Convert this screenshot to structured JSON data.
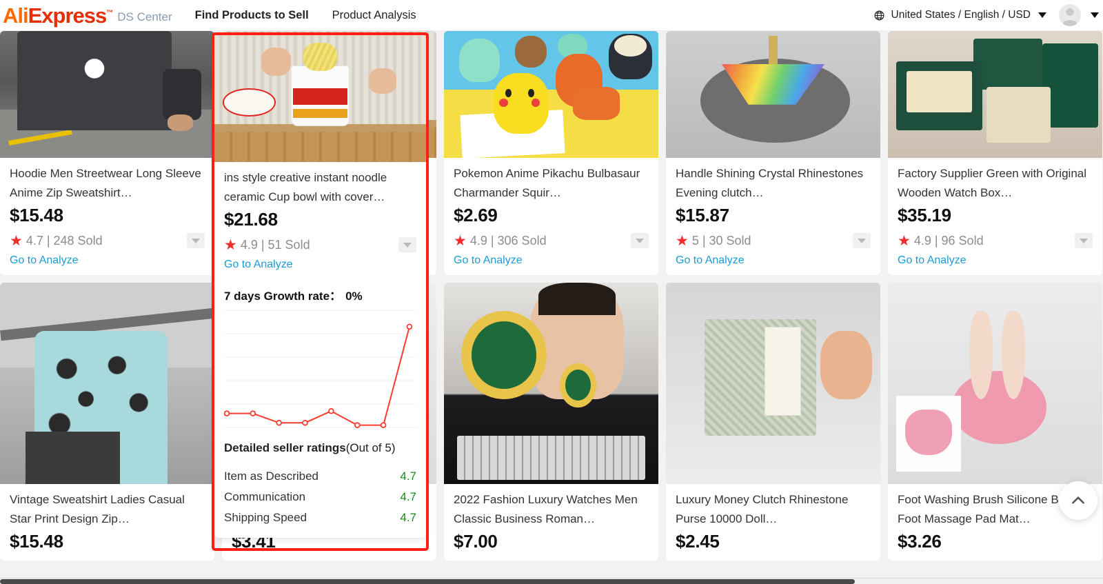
{
  "header": {
    "logo_ali": "Ali",
    "logo_express": "Express",
    "ds_center": "DS Center",
    "nav": [
      {
        "label": "Find Products to Sell",
        "active": true
      },
      {
        "label": "Product Analysis",
        "active": false
      }
    ],
    "locale": "United States / English / USD",
    "globe_icon": "globe-icon",
    "caret_icon": "caret-down-icon",
    "avatar_icon": "avatar-icon"
  },
  "grid": {
    "row1": [
      {
        "title": "Hoodie Men Streetwear Long Sleeve Anime Zip Sweatshirt…",
        "price": "$15.48",
        "rating": "4.7 | 248 Sold",
        "analyze": "Go to Analyze",
        "star_icon": "star-icon",
        "expand_icon": "chevron-down-icon"
      },
      {
        "title": "ins style creative instant noodle ceramic Cup bowl with cover…",
        "price": "$21.68",
        "rating": "4.9 | 51 Sold",
        "analyze": "Go to Analyze",
        "star_icon": "star-icon",
        "expand_icon": "chevron-down-icon"
      },
      {
        "title": "Pokemon Anime Pikachu Bulbasaur Charmander Squir…",
        "price": "$2.69",
        "rating": "4.9 | 306 Sold",
        "analyze": "Go to Analyze",
        "star_icon": "star-icon",
        "expand_icon": "chevron-down-icon"
      },
      {
        "title": "Handle Shining Crystal Rhinestones Evening clutch…",
        "price": "$15.87",
        "rating": "5 | 30 Sold",
        "analyze": "Go to Analyze",
        "star_icon": "star-icon",
        "expand_icon": "chevron-down-icon"
      },
      {
        "title": "Factory Supplier Green with Original Wooden Watch Box…",
        "price": "$35.19",
        "rating": "4.9 | 96 Sold",
        "analyze": "Go to Analyze",
        "star_icon": "star-icon",
        "expand_icon": "chevron-down-icon"
      }
    ],
    "row2": [
      {
        "title": "Vintage Sweatshirt Ladies Casual Star Print Design Zip…",
        "price": "$15.48"
      },
      {
        "title": "",
        "price": "$3.41"
      },
      {
        "title": "2022 Fashion Luxury Watches Men Classic Business Roman…",
        "price": "$7.00"
      },
      {
        "title": "Luxury Money Clutch Rhinestone Purse 10000 Doll…",
        "price": "$2.45"
      },
      {
        "title": "Foot Washing Brush Silicone Bath Foot Massage Pad Mat…",
        "price": "$3.26"
      }
    ]
  },
  "expanded_panel": {
    "growth_label": "7 days Growth rate：",
    "growth_value": "0%",
    "dsr_title_bold": "Detailed seller ratings",
    "dsr_title_rest": "(Out of 5)",
    "ratings": [
      {
        "label": "Item as Described",
        "value": "4.7"
      },
      {
        "label": "Communication",
        "value": "4.7"
      },
      {
        "label": "Shipping Speed",
        "value": "4.7"
      }
    ],
    "highlight_color": "#ff1f14",
    "line_color": "#fb3b30",
    "value_color": "#1a8a1a"
  },
  "chart_data": {
    "type": "line",
    "title": "7 days Growth rate",
    "x": [
      1,
      2,
      3,
      4,
      5,
      6,
      7,
      8
    ],
    "values": [
      12,
      12,
      4,
      4,
      14,
      2,
      2,
      86
    ],
    "ylim": [
      0,
      100
    ],
    "xlabel": "",
    "ylabel": "",
    "grid": true,
    "legend": "none",
    "series_color": "#fb3b30",
    "marker": "open-circle"
  },
  "scroll_top": {
    "icon": "chevron-up-icon",
    "label": "Back to top"
  },
  "scrollbar": {
    "orientation": "horizontal"
  }
}
